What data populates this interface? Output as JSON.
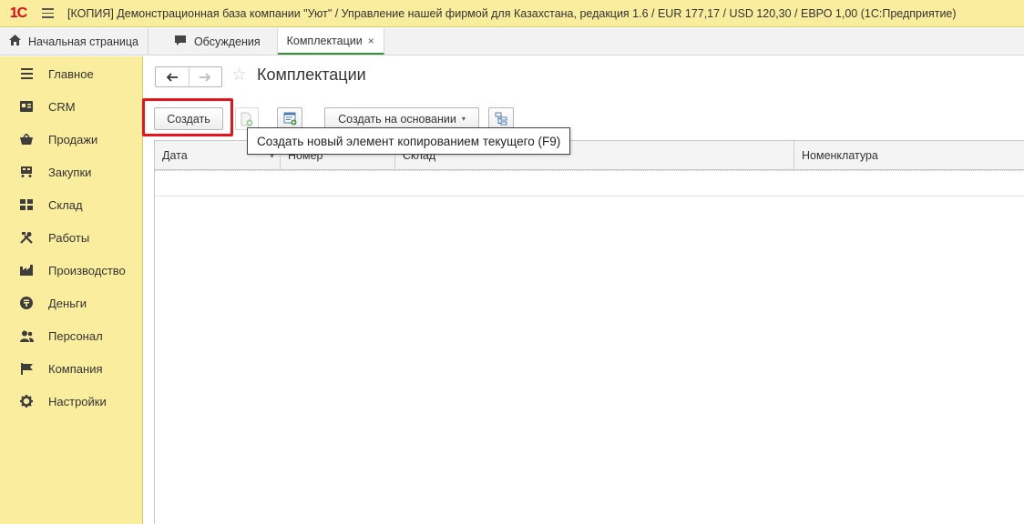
{
  "app": {
    "logo_text": "1С",
    "title": "[КОПИЯ] Демонстрационная база компании \"Уют\" / Управление нашей фирмой для Казахстана, редакция 1.6 / EUR 177,17 / USD 120,30 / ЕВРО 1,00  (1С:Предприятие)"
  },
  "tabs": [
    {
      "label": "Начальная страница",
      "icon": "home-icon"
    },
    {
      "label": "Обсуждения",
      "icon": "chat-icon"
    },
    {
      "label": "Комплектации",
      "icon": "",
      "active": true,
      "close": "×"
    }
  ],
  "sidebar": {
    "items": [
      {
        "label": "Главное",
        "icon": "list-icon"
      },
      {
        "label": "CRM",
        "icon": "crm-icon"
      },
      {
        "label": "Продажи",
        "icon": "basket-icon"
      },
      {
        "label": "Закупки",
        "icon": "cart-icon"
      },
      {
        "label": "Склад",
        "icon": "warehouse-icon"
      },
      {
        "label": "Работы",
        "icon": "tools-icon"
      },
      {
        "label": "Производство",
        "icon": "factory-icon"
      },
      {
        "label": "Деньги",
        "icon": "money-icon"
      },
      {
        "label": "Персонал",
        "icon": "people-icon"
      },
      {
        "label": "Компания",
        "icon": "flag-icon"
      },
      {
        "label": "Настройки",
        "icon": "gear-icon"
      }
    ]
  },
  "main": {
    "title": "Комплектации",
    "toolbar": {
      "create_label": "Создать",
      "based_on_label": "Создать на основании",
      "based_on_caret": "▾"
    },
    "table": {
      "columns": [
        "Дата",
        "Номер",
        "Склад",
        "Номенклатура"
      ],
      "sort_arrow": "▾",
      "rows": []
    },
    "tooltip": "Создать новый элемент копированием текущего (F9)"
  },
  "colors": {
    "sidebar_bg": "#fbed9e",
    "highlight": "#e8141c",
    "active_tab_underline": "#3a8e3a"
  }
}
